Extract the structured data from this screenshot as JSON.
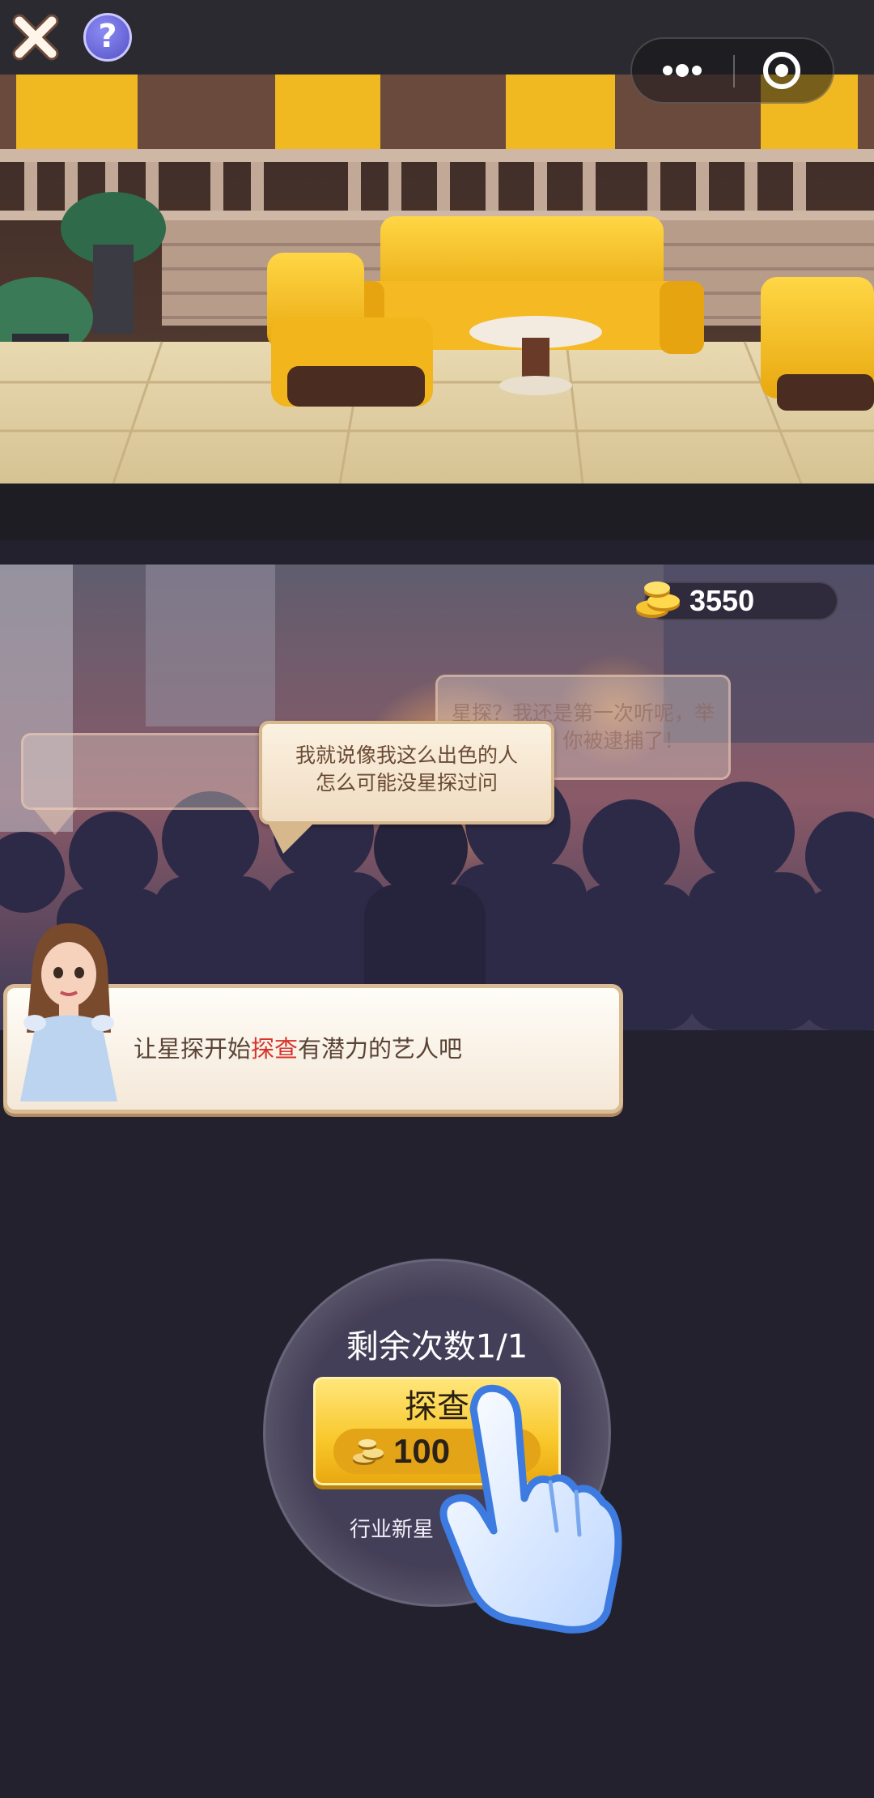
{
  "topbar": {
    "close_icon": "close-icon",
    "help_icon": "help-icon",
    "help_label": "?",
    "menu_icon": "more-dots-icon",
    "target_icon": "record-target-icon"
  },
  "coins": {
    "amount": "3550",
    "icon": "coin-stack-icon"
  },
  "bubbles": {
    "left_faded": "",
    "right_faded_line1": "星探？我还是第一次听呢，举",
    "right_faded_line2": "起手来，你被逮捕了！",
    "main_line1": "我就说像我这么出色的人",
    "main_line2": "怎么可能没星探过问"
  },
  "guide": {
    "text_before": "让星探开始",
    "text_highlight": "探查",
    "text_after": "有潜力的艺人吧"
  },
  "action": {
    "remaining_label": "剩余次数1/1",
    "button_label": "探查",
    "cost": "100",
    "rank": "行业新星"
  },
  "colors": {
    "background": "#24212f",
    "button_gold": "#f8c72a",
    "highlight_red": "#d8332b",
    "sofa_yellow": "#f4c21f"
  }
}
